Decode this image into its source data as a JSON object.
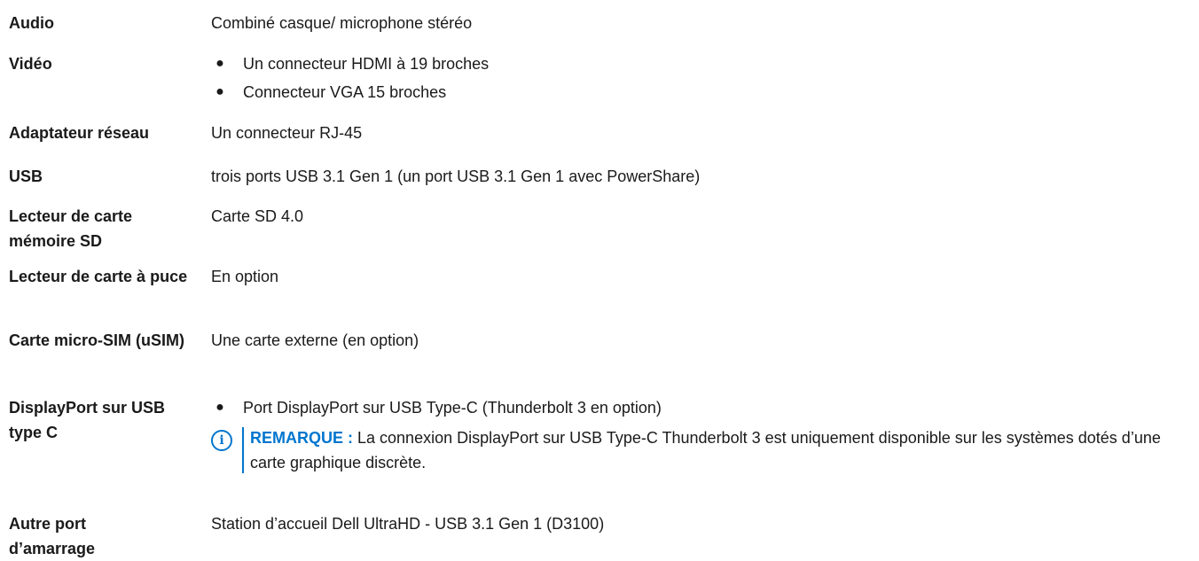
{
  "rows": [
    {
      "label": "Audio",
      "value": "Combiné casque/ microphone stéréo"
    },
    {
      "label": "Vidéo",
      "bullets": [
        "Un connecteur HDMI à 19 broches",
        "Connecteur VGA 15 broches"
      ]
    },
    {
      "label": "Adaptateur réseau",
      "value": "Un connecteur RJ-45"
    },
    {
      "label": "USB",
      "value": "trois ports USB 3.1 Gen 1 (un port USB 3.1 Gen 1 avec PowerShare)"
    },
    {
      "label": "Lecteur de carte mémoire SD",
      "value": "Carte SD 4.0"
    },
    {
      "label": "Lecteur de carte à puce",
      "value": "En option"
    },
    {
      "label": "Carte micro-SIM (uSIM)",
      "value": "Une carte externe (en option)"
    },
    {
      "label": "DisplayPort sur USB type C",
      "bullets": [
        "Port DisplayPort sur USB Type-C (Thunderbolt 3 en option)"
      ],
      "note": {
        "icon": "info-icon",
        "title": "REMARQUE :",
        "text": "La connexion DisplayPort sur USB Type-C Thunderbolt 3 est uniquement disponible sur les systèmes dotés d’une carte graphique discrète."
      }
    },
    {
      "label": "Autre port d’amarrage",
      "value": "Station d’accueil Dell UltraHD - USB 3.1 Gen 1 (D3100)"
    }
  ],
  "colors": {
    "accent": "#0076ce",
    "text": "#1a1a1a"
  }
}
